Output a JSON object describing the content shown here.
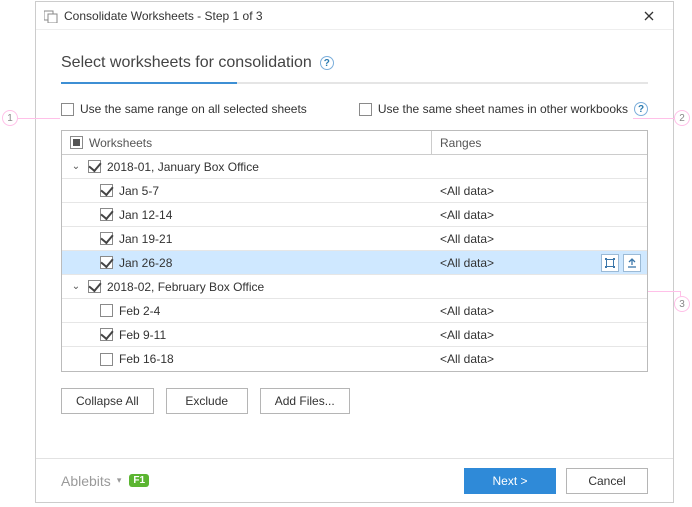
{
  "titlebar": {
    "title": "Consolidate Worksheets - Step 1 of 3"
  },
  "heading": {
    "text": "Select worksheets for consolidation"
  },
  "options": {
    "same_range_label": "Use the same range on all selected sheets",
    "same_names_label": "Use the same sheet names in other workbooks"
  },
  "columns": {
    "worksheets": "Worksheets",
    "ranges": "Ranges"
  },
  "groups": [
    {
      "label": "2018-01, January Box Office",
      "checked": true,
      "expanded": true,
      "items": [
        {
          "label": "Jan 5-7",
          "checked": true,
          "range": "<All data>",
          "selected": false
        },
        {
          "label": "Jan 12-14",
          "checked": true,
          "range": "<All data>",
          "selected": false
        },
        {
          "label": "Jan 19-21",
          "checked": true,
          "range": "<All data>",
          "selected": false
        },
        {
          "label": "Jan 26-28",
          "checked": true,
          "range": "<All data>",
          "selected": true
        }
      ]
    },
    {
      "label": "2018-02, February Box Office",
      "checked": true,
      "expanded": true,
      "items": [
        {
          "label": "Feb 2-4",
          "checked": false,
          "range": "<All data>",
          "selected": false
        },
        {
          "label": "Feb 9-11",
          "checked": true,
          "range": "<All data>",
          "selected": false
        },
        {
          "label": "Feb 16-18",
          "checked": false,
          "range": "<All data>",
          "selected": false
        }
      ]
    }
  ],
  "buttons": {
    "collapse_all": "Collapse All",
    "exclude": "Exclude",
    "add_files": "Add Files...",
    "next": "Next >",
    "cancel": "Cancel"
  },
  "footer": {
    "brand": "Ablebits",
    "f1": "F1"
  },
  "annotations": {
    "a1": "1",
    "a2": "2",
    "a3": "3"
  }
}
